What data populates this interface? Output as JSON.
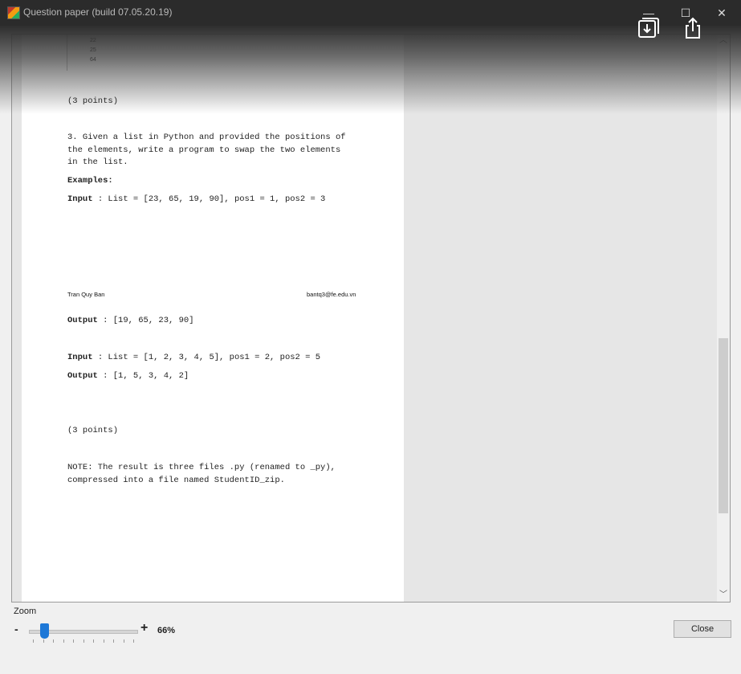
{
  "window": {
    "title": "Question paper (build 07.05.20.19)",
    "controls": {
      "minimize": "—",
      "maximize": "☐",
      "close": "✕"
    }
  },
  "overlay_icons": [
    "save-screenshot-icon",
    "share-icon"
  ],
  "document": {
    "code_lines": [
      "22",
      "25",
      "64"
    ],
    "points_1": "(3 points)",
    "question_3": [
      "3. Given a list in Python and provided the positions of",
      "the elements, write a program to swap the two elements",
      "in the list."
    ],
    "examples_label": "Examples:",
    "input_label": "Input",
    "example1_input": " : List = [23, 65, 19, 90], pos1 = 1, pos2 = 3",
    "footer_name": "Tran Quy Ban",
    "footer_email": "bantq3@fe.edu.vn",
    "output_label": "Output",
    "example1_output": " : [19, 65, 23, 90]",
    "example2_input": " : List = [1, 2, 3, 4, 5], pos1 = 2, pos2 = 5",
    "example2_output": " : [1, 5, 3, 4, 2]",
    "points_2": "(3 points)",
    "note": [
      "NOTE: The result is three files .py (renamed to _py),",
      "compressed into a file named StudentID_zip."
    ]
  },
  "zoom": {
    "label": "Zoom",
    "minus": "-",
    "plus": "+",
    "value": "66%",
    "slider_fraction": 0.14
  },
  "buttons": {
    "close": "Close"
  },
  "colors": {
    "titlebar": "#2b2b2b",
    "slider_thumb": "#1e78d7"
  }
}
